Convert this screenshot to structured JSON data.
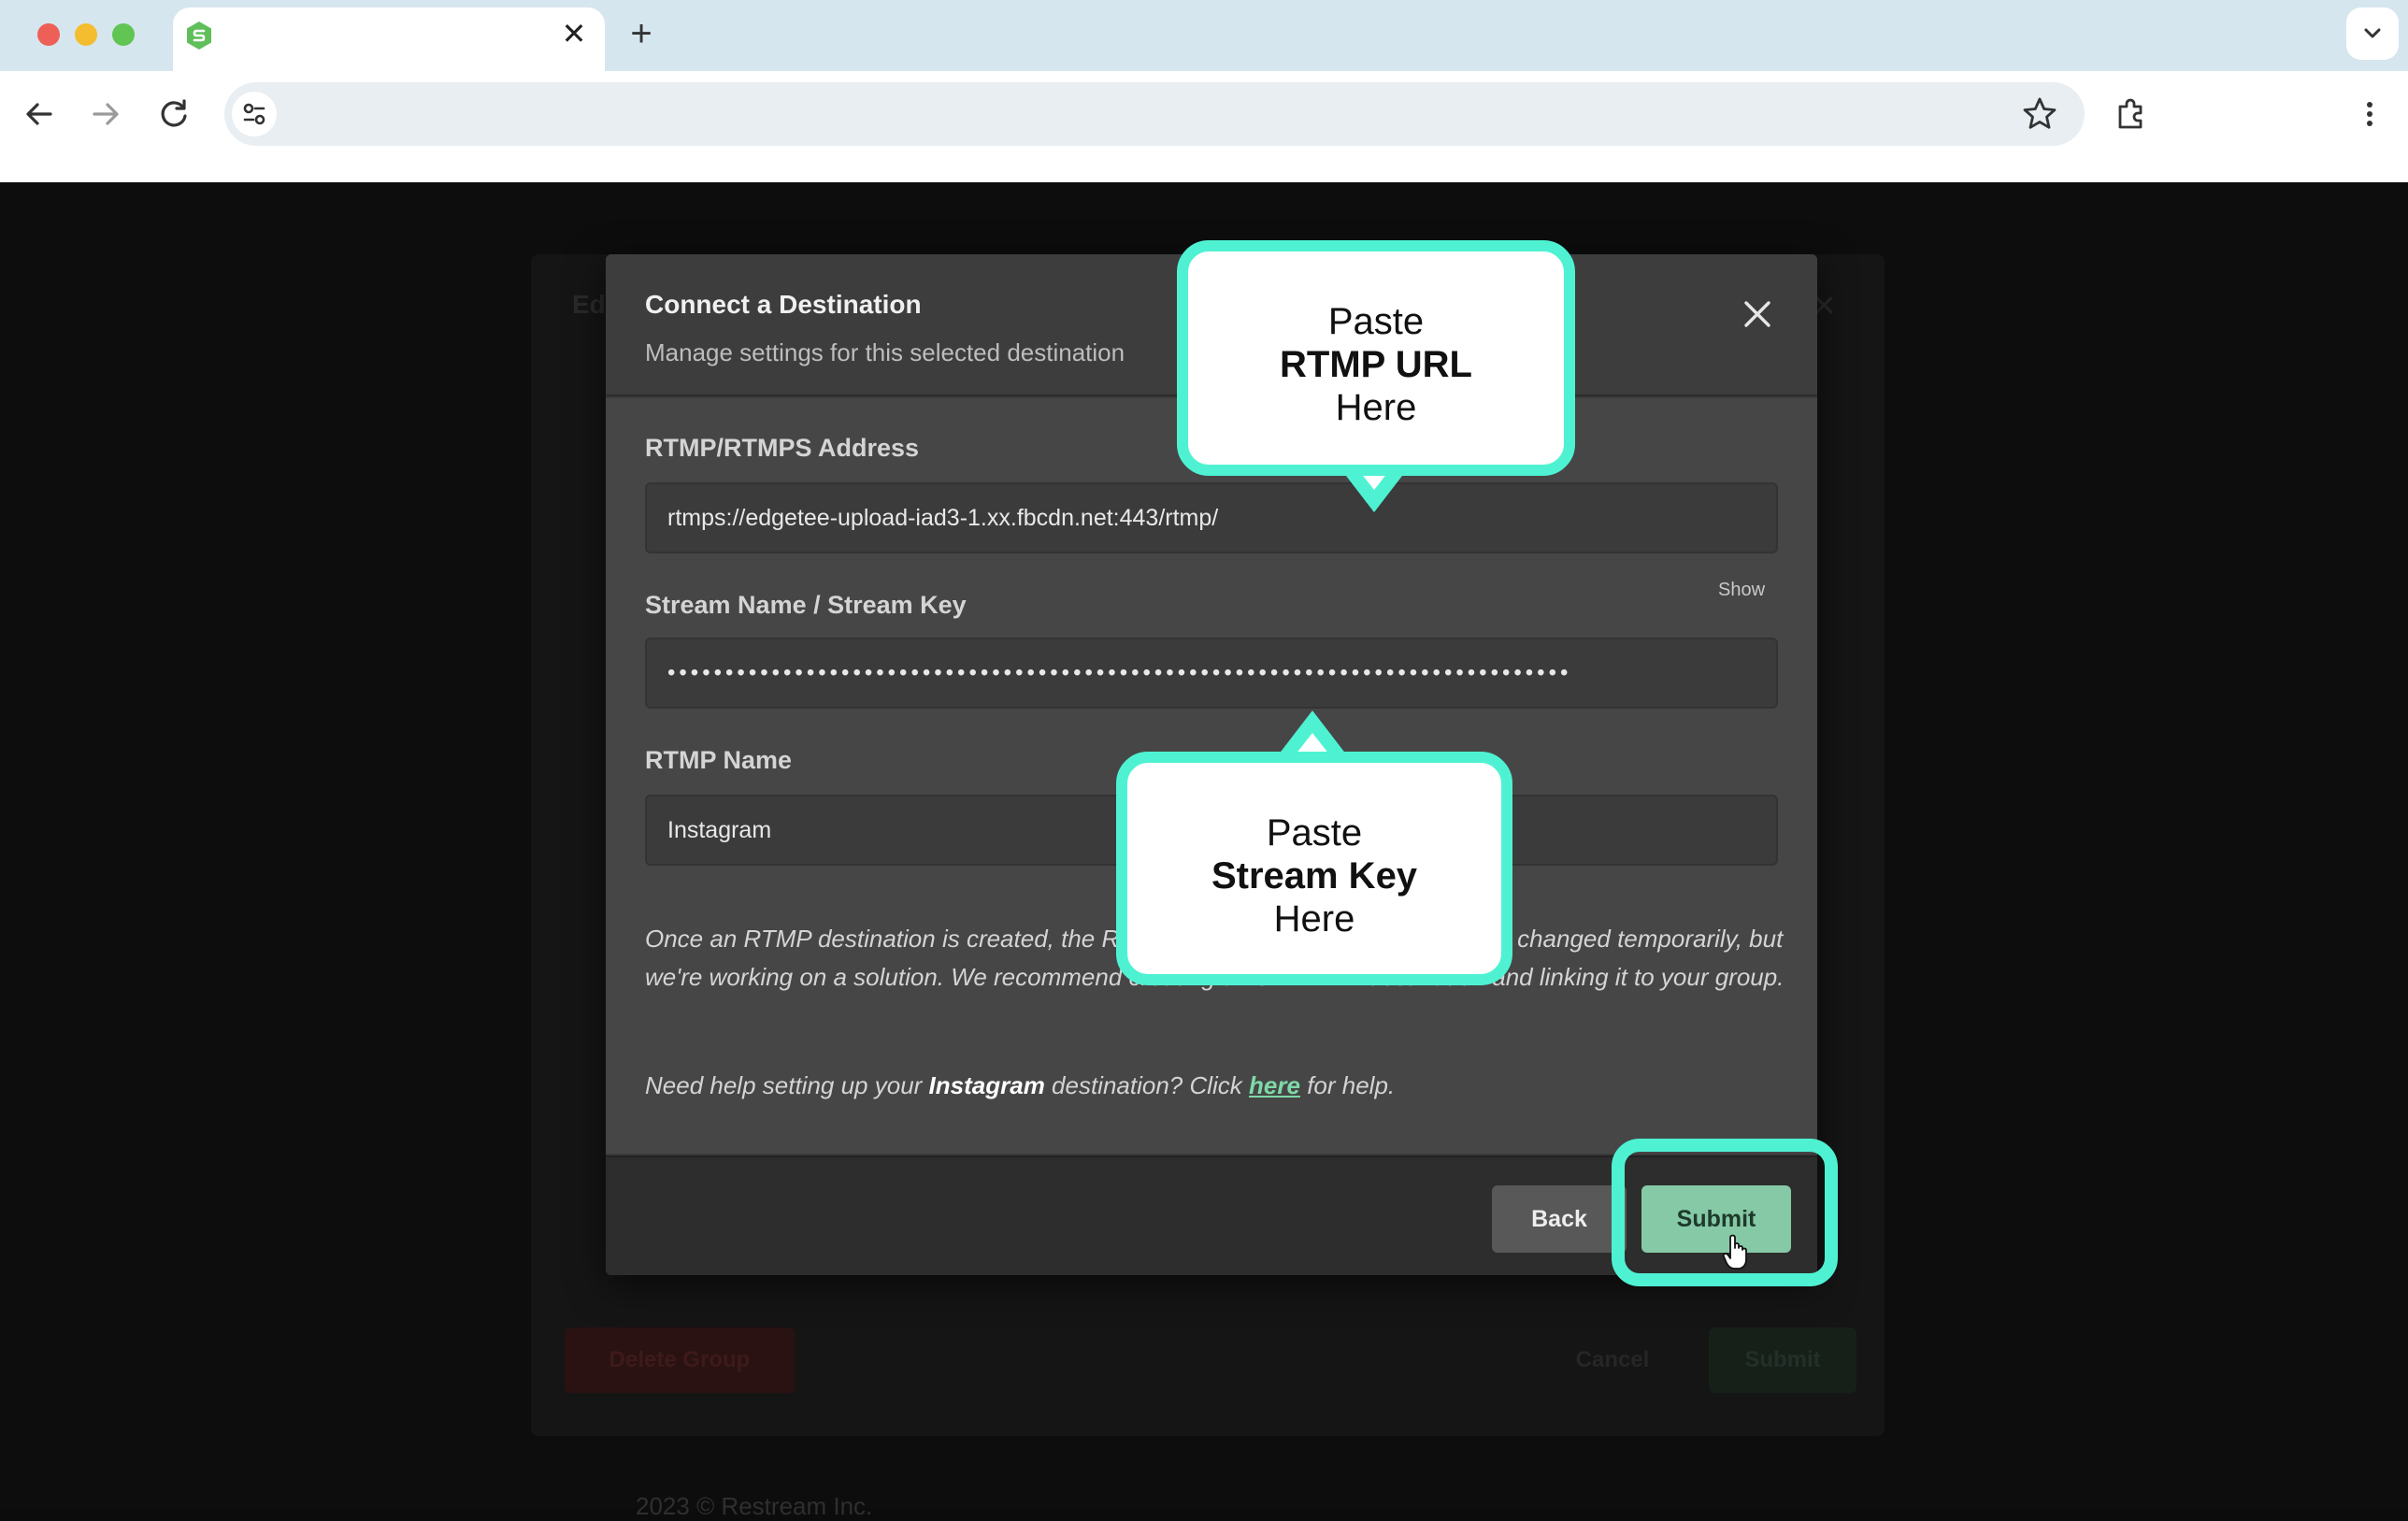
{
  "browser": {
    "tab_close_glyph": "✕",
    "new_tab_glyph": "+",
    "accent": "#4ef2d3"
  },
  "background_page": {
    "title": "Ed",
    "close_glyph": "✕",
    "delete_label": "Delete Group",
    "cancel_label": "Cancel",
    "submit_label": "Submit",
    "footer_text": "2023 © Restream Inc."
  },
  "dialog": {
    "title": "Connect a Destination",
    "subtitle": "Manage settings for this selected destination",
    "fields": {
      "rtmp_address": {
        "label": "RTMP/RTMPS Address",
        "value": "rtmps://edgetee-upload-iad3-1.xx.fbcdn.net:443/rtmp/"
      },
      "stream_key": {
        "label": "Stream Name / Stream Key",
        "toggle_label": "Show",
        "masked_value": "••••••••••••••••••••••••••••••••••••••••••••••••••••••••••••••••••••••••••••••"
      },
      "rtmp_name": {
        "label": "RTMP Name",
        "value": "Instagram"
      }
    },
    "note": "Once an RTMP destination is created, the RTMP URL and stream key cannot be changed temporarily, but we're working on a solution. We recommend creating a new RTMP destination and linking it to your group.",
    "help": {
      "prefix": "Need help setting up your ",
      "platform": "Instagram",
      "middle": " destination? Click ",
      "link": "here",
      "suffix": " for help."
    },
    "back_label": "Back",
    "submit_label": "Submit"
  },
  "callouts": {
    "url": {
      "line1": "Paste",
      "line2": "RTMP URL",
      "line3": "Here"
    },
    "key": {
      "line1": "Paste",
      "line2": "Stream Key",
      "line3": "Here"
    }
  },
  "icons": {
    "back": "arrow-left-icon",
    "forward": "arrow-right-icon",
    "reload": "reload-icon",
    "site_info": "tune-icon",
    "bookmark": "star-icon",
    "extensions": "puzzle-icon",
    "menu": "kebab-menu-icon",
    "dialog_close": "close-icon",
    "cursor": "hand-pointer-icon"
  }
}
